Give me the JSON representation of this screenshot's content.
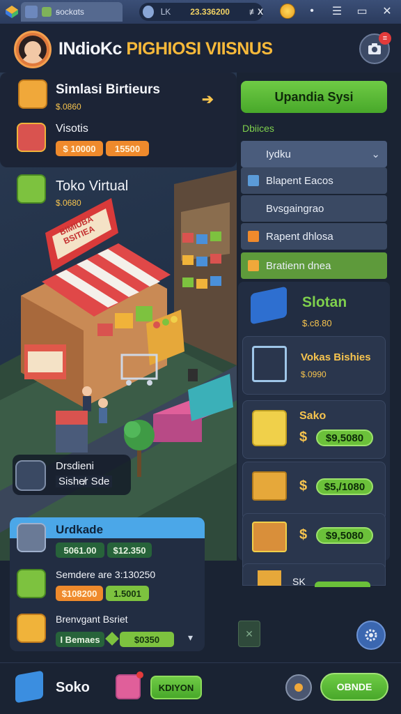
{
  "window": {
    "tab_label": "ꞩockɑts",
    "counter_label": "ᒪK",
    "counter_value": "23.336200",
    "close_glyph": "≢X"
  },
  "header": {
    "title_white": "INdioKc",
    "title_gold": "PIGHIOSI VIISNUS",
    "notification_count": "≡"
  },
  "left_panel": {
    "sim_title": "Simlasi Birtieurs",
    "sim_price": "$.0860",
    "visits_label": "Visotis",
    "visits_price_a": "$ 10000",
    "visits_price_b": "15500",
    "store_title": "Toko Virtual",
    "store_price": "$.0680",
    "shop_sign": "BIMIUBA\nBSITIEA"
  },
  "scene_tooltip": {
    "line1": "Drsdieni",
    "line2": "Sishe̸ɾ Sde"
  },
  "upgrade_panel": {
    "title": "Uɾdkade",
    "price_a": "5061.00",
    "price_b": "$12.350",
    "row2_label": "Semdere are 3:130250",
    "row2_price_a": "$108200",
    "row2_price_b": "1.5001",
    "row3_label": "Brenvgant Bsriet",
    "row3_price_a": "I Bemaes",
    "row3_price_b": "$0350"
  },
  "right_panel": {
    "primary_button": "Upandia Sysi",
    "section_label": "Dbiices",
    "dropdown_value": "Iydku",
    "menu_items": [
      {
        "label": "Blapent Eacos",
        "color": "#5b9bd8"
      },
      {
        "label": "Bvsgaingrao",
        "color": ""
      },
      {
        "label": "Rapent dhlosa",
        "color": "#ef8a2c"
      },
      {
        "label": "Bratienn dnea",
        "color": "#f0a83a"
      }
    ],
    "featured_title": "Slotan",
    "featured_price": "$.c8.80",
    "shop_items": [
      {
        "name": "Vokas Bishies",
        "sub": "$.0990",
        "price": ""
      },
      {
        "name": "Sako",
        "sub": "",
        "price": "$9,5080"
      },
      {
        "name": "",
        "sub": "",
        "price": "$5,/1080"
      },
      {
        "name": "",
        "sub": "",
        "price": "$9,5080"
      },
      {
        "name": "SK",
        "sub": "",
        "price": ""
      }
    ]
  },
  "bottom_bar": {
    "shop_label": "Soko",
    "green_button": "KDIYON",
    "right_button": "OBNDE"
  },
  "colors": {
    "accent_green": "#6bc13a",
    "accent_gold": "#f7c44e",
    "accent_orange": "#ef8a2c",
    "panel": "#2a364d"
  }
}
